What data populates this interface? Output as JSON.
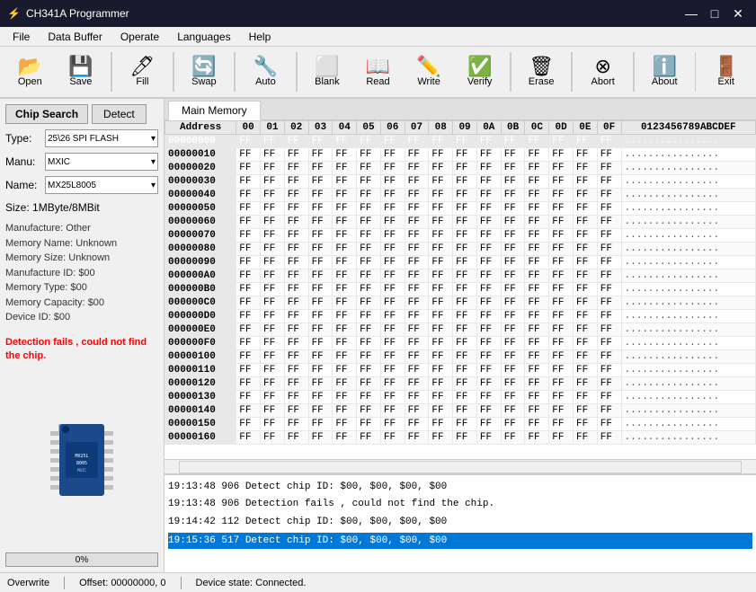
{
  "app": {
    "title": "CH341A Programmer",
    "title_icon": "⚡"
  },
  "titlebar": {
    "minimize_label": "—",
    "maximize_label": "□",
    "close_label": "✕"
  },
  "menubar": {
    "items": [
      {
        "label": "File",
        "id": "file"
      },
      {
        "label": "Data Buffer",
        "id": "data-buffer"
      },
      {
        "label": "Operate",
        "id": "operate"
      },
      {
        "label": "Languages",
        "id": "languages"
      },
      {
        "label": "Help",
        "id": "help"
      }
    ]
  },
  "toolbar": {
    "buttons": [
      {
        "id": "open",
        "label": "Open",
        "icon": "📂"
      },
      {
        "id": "save",
        "label": "Save",
        "icon": "💾"
      },
      {
        "id": "fill",
        "label": "Fill",
        "icon": "🖊"
      },
      {
        "id": "swap",
        "label": "Swap",
        "icon": "🔄"
      },
      {
        "id": "auto",
        "label": "Auto",
        "icon": "🔧"
      },
      {
        "id": "blank",
        "label": "Blank",
        "icon": "⬜"
      },
      {
        "id": "read",
        "label": "Read",
        "icon": "📖"
      },
      {
        "id": "write",
        "label": "Write",
        "icon": "✏️"
      },
      {
        "id": "verify",
        "label": "Verify",
        "icon": "✅"
      },
      {
        "id": "erase",
        "label": "Erase",
        "icon": "🗑"
      },
      {
        "id": "abort",
        "label": "Abort",
        "icon": "⊗"
      },
      {
        "id": "about",
        "label": "About",
        "icon": "ℹ️"
      },
      {
        "id": "exit",
        "label": "Exit",
        "icon": "🚪"
      }
    ]
  },
  "left_panel": {
    "chip_search_label": "Chip Search",
    "detect_label": "Detect",
    "type_label": "Type:",
    "type_value": "25\\26 SPI FLASH",
    "manu_label": "Manu:",
    "manu_value": "MXIC",
    "name_label": "Name:",
    "name_value": "MX25L8005",
    "size_label": "Size:",
    "size_value": "1MByte/8MBit",
    "info_lines": [
      "Manufacture: Other",
      "Memory Name: Unknown",
      "Memory Size: Unknown",
      "Manufacture ID: $00",
      "Memory Type: $00",
      "Memory Capacity: $00",
      "Device ID: $00"
    ],
    "error_text": "Detection fails , could not find the chip.",
    "progress_value": "0%"
  },
  "tabs": [
    {
      "label": "Main Memory",
      "active": true
    }
  ],
  "hex_table": {
    "headers": [
      "Address",
      "00",
      "01",
      "02",
      "03",
      "04",
      "05",
      "06",
      "07",
      "08",
      "09",
      "0A",
      "0B",
      "0C",
      "0D",
      "0E",
      "0F",
      "0123456789ABCDEF"
    ],
    "rows": [
      {
        "addr": "00000000",
        "selected": true,
        "bytes": "FF FF FF FF FF FF FF FF FF FF FF FF FF FF FF FF",
        "ascii": "................"
      },
      {
        "addr": "00000010",
        "selected": false,
        "bytes": "FF FF FF FF FF FF FF FF FF FF FF FF FF FF FF FF",
        "ascii": "................"
      },
      {
        "addr": "00000020",
        "selected": false,
        "bytes": "FF FF FF FF FF FF FF FF FF FF FF FF FF FF FF FF",
        "ascii": "................"
      },
      {
        "addr": "00000030",
        "selected": false,
        "bytes": "FF FF FF FF FF FF FF FF FF FF FF FF FF FF FF FF",
        "ascii": "................"
      },
      {
        "addr": "00000040",
        "selected": false,
        "bytes": "FF FF FF FF FF FF FF FF FF FF FF FF FF FF FF FF",
        "ascii": "................"
      },
      {
        "addr": "00000050",
        "selected": false,
        "bytes": "FF FF FF FF FF FF FF FF FF FF FF FF FF FF FF FF",
        "ascii": "................"
      },
      {
        "addr": "00000060",
        "selected": false,
        "bytes": "FF FF FF FF FF FF FF FF FF FF FF FF FF FF FF FF",
        "ascii": "................"
      },
      {
        "addr": "00000070",
        "selected": false,
        "bytes": "FF FF FF FF FF FF FF FF FF FF FF FF FF FF FF FF",
        "ascii": "................"
      },
      {
        "addr": "00000080",
        "selected": false,
        "bytes": "FF FF FF FF FF FF FF FF FF FF FF FF FF FF FF FF",
        "ascii": "................"
      },
      {
        "addr": "00000090",
        "selected": false,
        "bytes": "FF FF FF FF FF FF FF FF FF FF FF FF FF FF FF FF",
        "ascii": "................"
      },
      {
        "addr": "000000A0",
        "selected": false,
        "bytes": "FF FF FF FF FF FF FF FF FF FF FF FF FF FF FF FF",
        "ascii": "................"
      },
      {
        "addr": "000000B0",
        "selected": false,
        "bytes": "FF FF FF FF FF FF FF FF FF FF FF FF FF FF FF FF",
        "ascii": "................"
      },
      {
        "addr": "000000C0",
        "selected": false,
        "bytes": "FF FF FF FF FF FF FF FF FF FF FF FF FF FF FF FF",
        "ascii": "................"
      },
      {
        "addr": "000000D0",
        "selected": false,
        "bytes": "FF FF FF FF FF FF FF FF FF FF FF FF FF FF FF FF",
        "ascii": "................"
      },
      {
        "addr": "000000E0",
        "selected": false,
        "bytes": "FF FF FF FF FF FF FF FF FF FF FF FF FF FF FF FF",
        "ascii": "................"
      },
      {
        "addr": "000000F0",
        "selected": false,
        "bytes": "FF FF FF FF FF FF FF FF FF FF FF FF FF FF FF FF",
        "ascii": "................"
      },
      {
        "addr": "00000100",
        "selected": false,
        "bytes": "FF FF FF FF FF FF FF FF FF FF FF FF FF FF FF FF",
        "ascii": "................"
      },
      {
        "addr": "00000110",
        "selected": false,
        "bytes": "FF FF FF FF FF FF FF FF FF FF FF FF FF FF FF FF",
        "ascii": "................"
      },
      {
        "addr": "00000120",
        "selected": false,
        "bytes": "FF FF FF FF FF FF FF FF FF FF FF FF FF FF FF FF",
        "ascii": "................"
      },
      {
        "addr": "00000130",
        "selected": false,
        "bytes": "FF FF FF FF FF FF FF FF FF FF FF FF FF FF FF FF",
        "ascii": "................"
      },
      {
        "addr": "00000140",
        "selected": false,
        "bytes": "FF FF FF FF FF FF FF FF FF FF FF FF FF FF FF FF",
        "ascii": "................"
      },
      {
        "addr": "00000150",
        "selected": false,
        "bytes": "FF FF FF FF FF FF FF FF FF FF FF FF FF FF FF FF",
        "ascii": "................"
      },
      {
        "addr": "00000160",
        "selected": false,
        "bytes": "FF FF FF FF FF FF FF FF FF FF FF FF FF FF FF FF",
        "ascii": "................"
      }
    ]
  },
  "log": {
    "entries": [
      {
        "text": "19:13:48 906 Detect chip ID: $00, $00, $00, $00",
        "highlighted": false
      },
      {
        "text": "19:13:48 906 Detection fails , could not find the chip.",
        "highlighted": false
      },
      {
        "text": "",
        "highlighted": false
      },
      {
        "text": "19:14:42 112 Detect chip ID: $00, $00, $00, $00",
        "highlighted": false
      },
      {
        "text": "",
        "highlighted": false
      },
      {
        "text": "19:15:36 517 Detect chip ID: $00, $00, $00, $00",
        "highlighted": true
      }
    ]
  },
  "statusbar": {
    "overwrite": "Overwrite",
    "offset": "Offset: 00000000, 0",
    "device_state": "Device state: Connected."
  }
}
